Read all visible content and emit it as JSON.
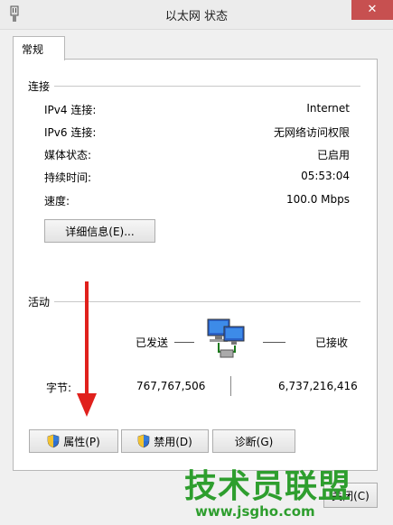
{
  "window": {
    "title": "以太网 状态",
    "close_glyph": "✕"
  },
  "tab": {
    "label": "常规"
  },
  "connection": {
    "group_label": "连接",
    "rows": [
      {
        "label": "IPv4 连接:",
        "value": "Internet"
      },
      {
        "label": "IPv6 连接:",
        "value": "无网络访问权限"
      },
      {
        "label": "媒体状态:",
        "value": "已启用"
      },
      {
        "label": "持续时间:",
        "value": "05:53:04"
      },
      {
        "label": "速度:",
        "value": "100.0 Mbps"
      }
    ],
    "details_button": "详细信息(E)..."
  },
  "activity": {
    "group_label": "活动",
    "sent_label": "已发送",
    "received_label": "已接收",
    "bytes_label": "字节:",
    "bytes_sent": "767,767,506",
    "bytes_received": "6,737,216,416"
  },
  "buttons": {
    "properties": "属性(P)",
    "disable": "禁用(D)",
    "diagnose": "诊断(G)",
    "close": "关闭(C)"
  },
  "watermark": {
    "text": "技术员联盟",
    "url": "www.jsgho.com"
  },
  "colors": {
    "close_button": "#c75050",
    "annotation_arrow": "#e0201c",
    "watermark": "#2e9e2e"
  },
  "icons": [
    "network-adapter-icon",
    "shield-icon",
    "network-computers-icon"
  ]
}
